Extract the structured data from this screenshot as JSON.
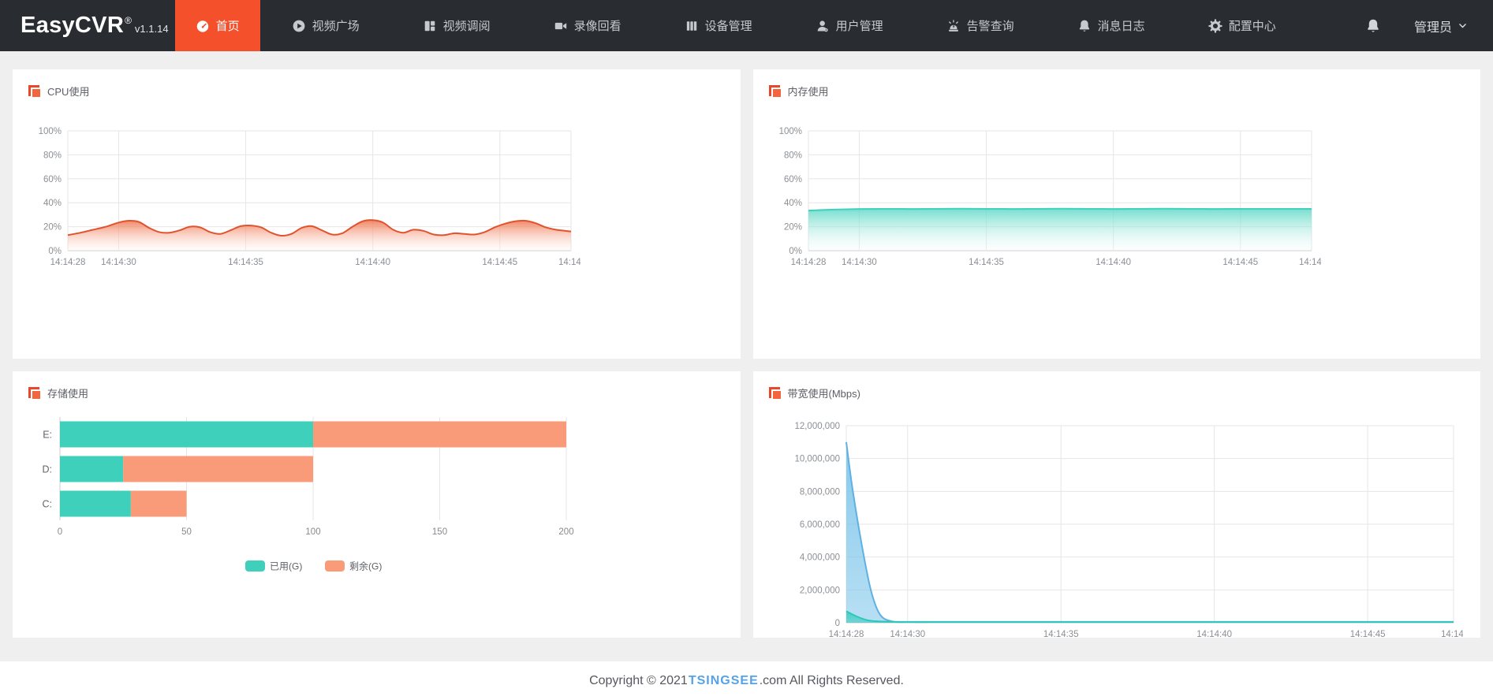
{
  "app": {
    "name": "EasyCVR",
    "reg_mark": "®",
    "version": "v1.1.14"
  },
  "nav": {
    "items": [
      {
        "name": "home",
        "label": "首页",
        "icon": "dashboard-icon",
        "active": true
      },
      {
        "name": "video-square",
        "label": "视频广场",
        "icon": "play-circle-icon",
        "active": false
      },
      {
        "name": "video-review",
        "label": "视频调阅",
        "icon": "layout-grid-icon",
        "active": false
      },
      {
        "name": "playback",
        "label": "录像回看",
        "icon": "video-camera-icon",
        "active": false
      },
      {
        "name": "devices",
        "label": "设备管理",
        "icon": "device-rack-icon",
        "active": false
      },
      {
        "name": "users",
        "label": "用户管理",
        "icon": "user-icon",
        "active": false
      },
      {
        "name": "alarms",
        "label": "告警查询",
        "icon": "alarm-siren-icon",
        "active": false
      },
      {
        "name": "messages",
        "label": "消息日志",
        "icon": "bell-icon",
        "active": false
      },
      {
        "name": "config",
        "label": "配置中心",
        "icon": "gear-icon",
        "active": false
      }
    ],
    "user_label": "管理员"
  },
  "footer": {
    "copyright_prefix": "Copyright © 2021 ",
    "brand": "TSINGSEE",
    "copyright_suffix": ".com All Rights Reserved."
  },
  "colors": {
    "navbar_bg": "#292c31",
    "active_tab": "#f4502c",
    "page_bg": "#efefef",
    "cpu_line": "#e0532f",
    "memory_line": "#3fd0be",
    "storage_used": "#3ed0ba",
    "storage_free": "#f99b78",
    "bandwidth_blue": "#5fb0e3",
    "bandwidth_teal": "#2ec7b9",
    "brand_blue": "#56a2e8"
  },
  "chart_data": [
    {
      "id": "cpu",
      "type": "area",
      "title": "CPU使用",
      "x_range": [
        28,
        47.8
      ],
      "x_ticks": [
        {
          "t": 28,
          "label": "14:14:28"
        },
        {
          "t": 30,
          "label": "14:14:30"
        },
        {
          "t": 35,
          "label": "14:14:35"
        },
        {
          "t": 40,
          "label": "14:14:40"
        },
        {
          "t": 45,
          "label": "14:14:45"
        },
        {
          "t": 47.8,
          "label": "14:14:"
        }
      ],
      "y_range": [
        0,
        100
      ],
      "y_ticks": [
        "0%",
        "20%",
        "40%",
        "60%",
        "80%",
        "100%"
      ],
      "series": [
        {
          "name": "cpu-usage-percent",
          "color": "#e0532f",
          "fill_from": "rgba(238,111,71,0.85)",
          "fill_to": "rgba(255,244,240,0.25)",
          "points": [
            [
              28,
              13
            ],
            [
              28.5,
              15
            ],
            [
              29,
              17.5
            ],
            [
              29.5,
              20
            ],
            [
              30,
              23.5
            ],
            [
              30.4,
              25
            ],
            [
              30.8,
              24
            ],
            [
              31.2,
              19
            ],
            [
              31.6,
              15.5
            ],
            [
              32,
              15
            ],
            [
              32.4,
              17
            ],
            [
              32.8,
              20
            ],
            [
              33.2,
              19.5
            ],
            [
              33.6,
              15.5
            ],
            [
              34,
              14
            ],
            [
              34.4,
              17
            ],
            [
              34.8,
              20.5
            ],
            [
              35.2,
              21
            ],
            [
              35.6,
              19.5
            ],
            [
              36,
              15
            ],
            [
              36.4,
              12.5
            ],
            [
              36.8,
              14
            ],
            [
              37.2,
              19
            ],
            [
              37.6,
              20.5
            ],
            [
              38,
              17
            ],
            [
              38.4,
              13.5
            ],
            [
              38.8,
              14.5
            ],
            [
              39.2,
              20
            ],
            [
              39.6,
              24.5
            ],
            [
              40,
              25.5
            ],
            [
              40.4,
              23.5
            ],
            [
              40.8,
              17.5
            ],
            [
              41.2,
              15
            ],
            [
              41.6,
              17.5
            ],
            [
              42,
              16.5
            ],
            [
              42.4,
              13.5
            ],
            [
              42.8,
              13
            ],
            [
              43.2,
              14.5
            ],
            [
              43.6,
              14
            ],
            [
              44,
              13.5
            ],
            [
              44.4,
              15.5
            ],
            [
              44.8,
              19.5
            ],
            [
              45.2,
              22.5
            ],
            [
              45.6,
              24.5
            ],
            [
              46,
              25
            ],
            [
              46.4,
              23
            ],
            [
              46.8,
              19.5
            ],
            [
              47.2,
              17.5
            ],
            [
              47.8,
              16
            ]
          ]
        }
      ]
    },
    {
      "id": "memory",
      "type": "area",
      "title": "内存使用",
      "x_range": [
        28,
        47.8
      ],
      "x_ticks": [
        {
          "t": 28,
          "label": "14:14:28"
        },
        {
          "t": 30,
          "label": "14:14:30"
        },
        {
          "t": 35,
          "label": "14:14:35"
        },
        {
          "t": 40,
          "label": "14:14:40"
        },
        {
          "t": 45,
          "label": "14:14:45"
        },
        {
          "t": 47.8,
          "label": "14:14:"
        }
      ],
      "y_range": [
        0,
        100
      ],
      "y_ticks": [
        "0%",
        "20%",
        "40%",
        "60%",
        "80%",
        "100%"
      ],
      "series": [
        {
          "name": "memory-usage-percent",
          "color": "#3fd0be",
          "fill_from": "rgba(84,214,195,0.8)",
          "fill_to": "rgba(242,252,250,0.2)",
          "points": [
            [
              28,
              33.5
            ],
            [
              29,
              34.3
            ],
            [
              30,
              34.8
            ],
            [
              31,
              34.9
            ],
            [
              32,
              34.8
            ],
            [
              33,
              34.9
            ],
            [
              34,
              35
            ],
            [
              35,
              34.9
            ],
            [
              36,
              34.8
            ],
            [
              37,
              34.9
            ],
            [
              38,
              35
            ],
            [
              39,
              34.9
            ],
            [
              40,
              34.8
            ],
            [
              41,
              34.9
            ],
            [
              42,
              35
            ],
            [
              43,
              34.9
            ],
            [
              44,
              34.8
            ],
            [
              45,
              34.9
            ],
            [
              46,
              34.9
            ],
            [
              47,
              34.9
            ],
            [
              47.8,
              34.9
            ]
          ]
        }
      ]
    },
    {
      "id": "storage",
      "type": "hbar",
      "title": "存储使用",
      "categories": [
        "E:",
        "D:",
        "C:"
      ],
      "x_ticks": [
        0,
        50,
        100,
        150,
        200
      ],
      "x_range": [
        0,
        200
      ],
      "legend": [
        {
          "label": "已用(G)",
          "color": "#3ed0ba"
        },
        {
          "label": "剩余(G)",
          "color": "#f99b78"
        }
      ],
      "series": [
        {
          "name": "已用(G)",
          "color": "#3ed0ba",
          "values": [
            100,
            25,
            28
          ]
        },
        {
          "name": "剩余(G)",
          "color": "#f99b78",
          "values": [
            100,
            75,
            22
          ]
        }
      ]
    },
    {
      "id": "bandwidth",
      "type": "area",
      "title": "带宽使用(Mbps)",
      "x_range": [
        28,
        47.8
      ],
      "x_ticks": [
        {
          "t": 28,
          "label": "14:14:28"
        },
        {
          "t": 30,
          "label": "14:14:30"
        },
        {
          "t": 35,
          "label": "14:14:35"
        },
        {
          "t": 40,
          "label": "14:14:40"
        },
        {
          "t": 45,
          "label": "14:14:45"
        },
        {
          "t": 47.8,
          "label": "14:14:"
        }
      ],
      "y_range": [
        0,
        12000000
      ],
      "y_ticks": [
        "0",
        "2,000,000",
        "4,000,000",
        "6,000,000",
        "8,000,000",
        "10,000,000",
        "12,000,000"
      ],
      "series": [
        {
          "name": "bandwidth-download",
          "color": "#5fb0e3",
          "fill_from": "rgba(124,197,234,0.92)",
          "fill_to": "rgba(124,197,234,0.55)",
          "points": [
            [
              28,
              11000000
            ],
            [
              28.2,
              8200000
            ],
            [
              28.5,
              4800000
            ],
            [
              28.8,
              2000000
            ],
            [
              29.1,
              500000
            ],
            [
              29.5,
              80000
            ],
            [
              30,
              40000
            ],
            [
              31,
              40000
            ],
            [
              33,
              40000
            ],
            [
              36,
              40000
            ],
            [
              40,
              40000
            ],
            [
              44,
              40000
            ],
            [
              47.8,
              40000
            ]
          ]
        },
        {
          "name": "bandwidth-upload",
          "color": "#2ec7b9",
          "fill_from": "rgba(64,204,190,0.9)",
          "fill_to": "rgba(64,204,190,0.6)",
          "points": [
            [
              28,
              700000
            ],
            [
              28.3,
              420000
            ],
            [
              28.7,
              150000
            ],
            [
              29.2,
              70000
            ],
            [
              30,
              55000
            ],
            [
              32,
              55000
            ],
            [
              35,
              55000
            ],
            [
              40,
              55000
            ],
            [
              44,
              55000
            ],
            [
              47.8,
              55000
            ]
          ]
        }
      ]
    }
  ]
}
